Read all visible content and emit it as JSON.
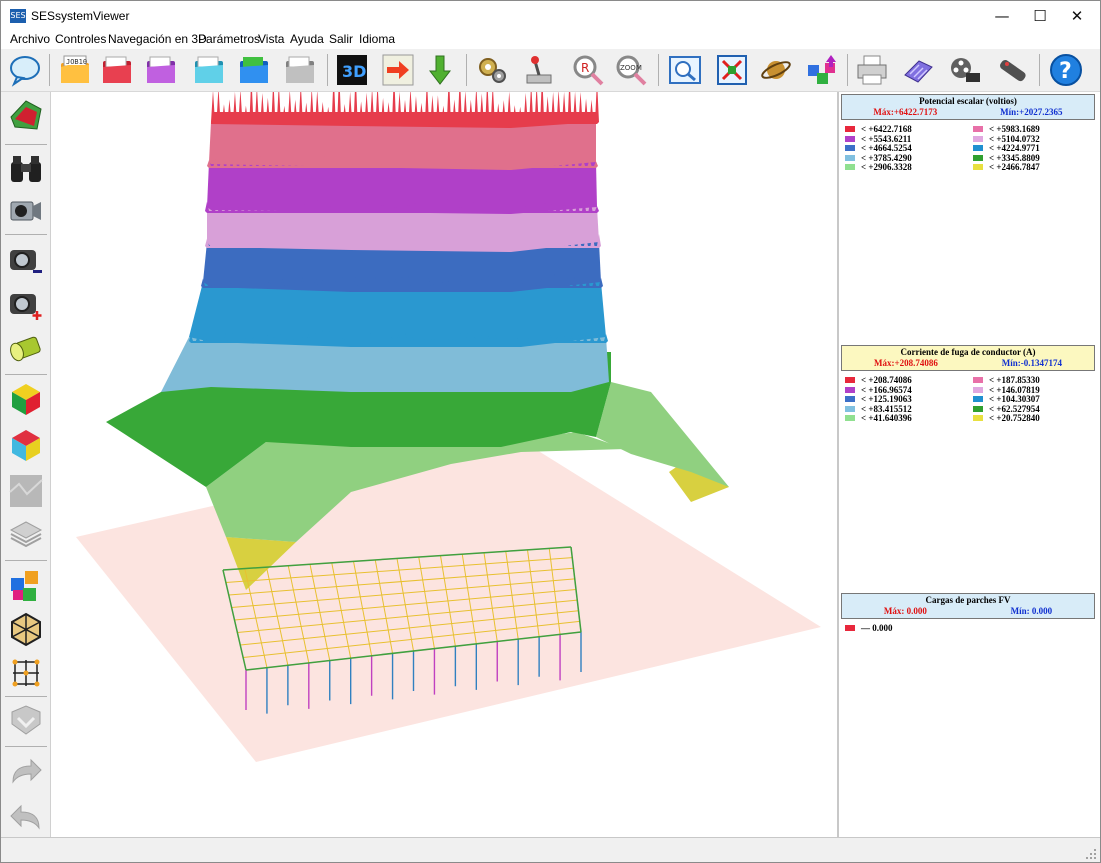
{
  "window": {
    "title": "SESsystemViewer",
    "icon_text": "SES",
    "minimize": "—",
    "maximize": "☐",
    "close": "✕"
  },
  "menu": [
    "Archivo",
    "Controles",
    "Navegación en 3D",
    "Parámetros",
    "Vista",
    "Ayuda",
    "Salir",
    "Idioma"
  ],
  "toolbar_icon_text": {
    "job": "JOB10",
    "zoom": "ZOOM",
    "three_d": "3D",
    "rect_letter": "R",
    "help": "?"
  },
  "legends": {
    "potential": {
      "title": "Potencial escalar (voltios)",
      "max": "Máx:+6422.7173",
      "min": "Mín:+2027.2365",
      "items": [
        {
          "label": "< +6422.7168",
          "color": "#e8283c"
        },
        {
          "label": "< +5983.1689",
          "color": "#e870a8"
        },
        {
          "label": "< +5543.6211",
          "color": "#b040c8"
        },
        {
          "label": "< +5104.0732",
          "color": "#e0a8e0"
        },
        {
          "label": "< +4664.5254",
          "color": "#3c70c8"
        },
        {
          "label": "< +4224.9771",
          "color": "#2090d0"
        },
        {
          "label": "< +3785.4290",
          "color": "#80c0e0"
        },
        {
          "label": "< +3345.8809",
          "color": "#30a030"
        },
        {
          "label": "< +2906.3328",
          "color": "#90e090"
        },
        {
          "label": "< +2466.7847",
          "color": "#e8e040"
        }
      ]
    },
    "current": {
      "title": "Corriente de fuga de conductor (A)",
      "max": "Máx:+208.74086",
      "min": "Mín:-0.1347174",
      "items": [
        {
          "label": "< +208.74086",
          "color": "#e8283c"
        },
        {
          "label": "< +187.85330",
          "color": "#e870a8"
        },
        {
          "label": "< +166.96574",
          "color": "#b040c8"
        },
        {
          "label": "< +146.07819",
          "color": "#e0a8e0"
        },
        {
          "label": "< +125.19063",
          "color": "#3c70c8"
        },
        {
          "label": "< +104.30307",
          "color": "#2090d0"
        },
        {
          "label": "< +83.415512",
          "color": "#80c0e0"
        },
        {
          "label": "< +62.527954",
          "color": "#30a030"
        },
        {
          "label": "< +41.640396",
          "color": "#90e090"
        },
        {
          "label": "< +20.752840",
          "color": "#e8e040"
        }
      ]
    },
    "pv": {
      "title": "Cargas de parches FV",
      "max": "Máx: 0.000",
      "min": "Mín: 0.000",
      "items": [
        {
          "label": "—   0.000",
          "color": "#e8283c"
        }
      ]
    }
  },
  "colors": {
    "band_red": "#e63c4c",
    "band_pink": "#e0708c",
    "band_purple": "#b040c8",
    "band_lavender": "#d8a0d8",
    "band_blue": "#3c6cc0",
    "band_cyan": "#2a98d0",
    "band_lightblue": "#80bcd8",
    "band_green": "#38a838",
    "band_lightgreen": "#90d080",
    "band_yellow": "#d8d040",
    "ground": "#fce4e0"
  }
}
